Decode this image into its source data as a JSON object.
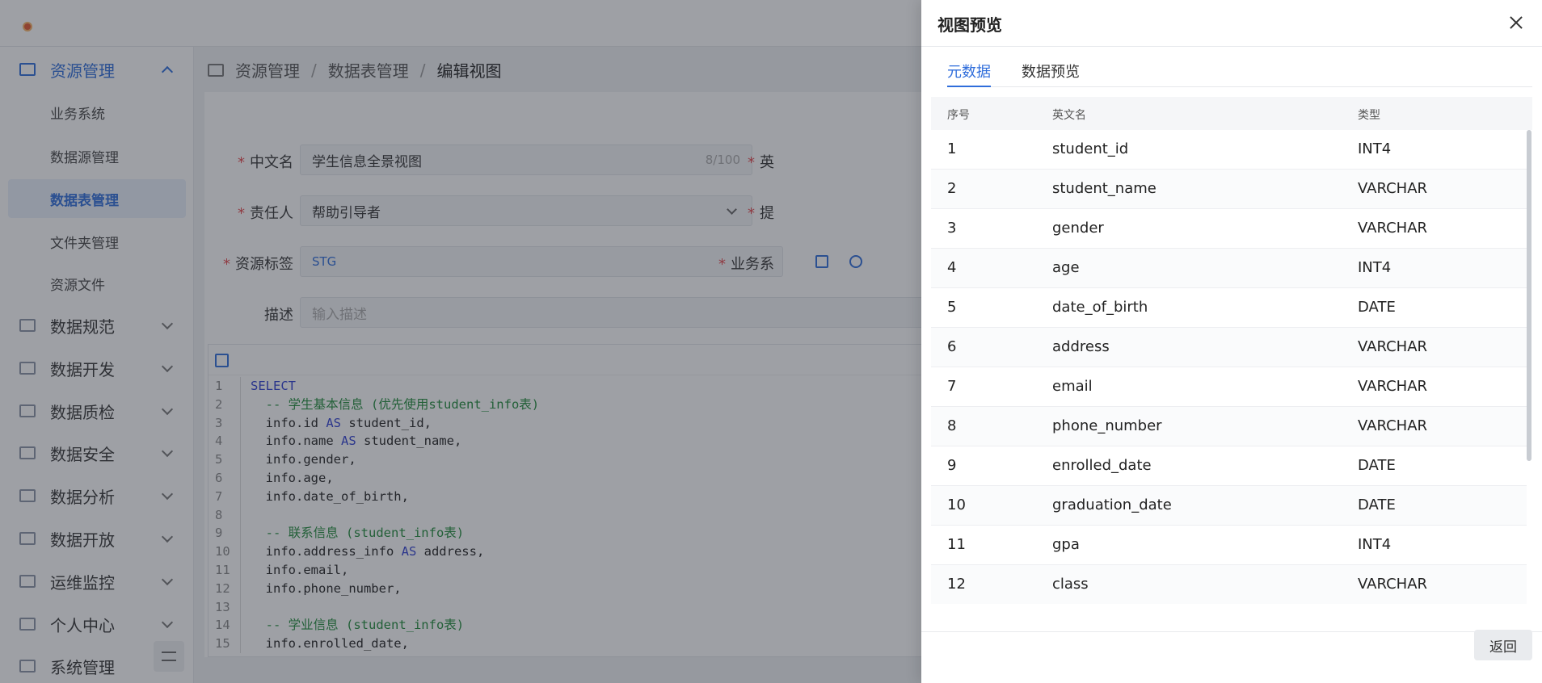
{
  "sidebar": {
    "groups": [
      {
        "label": "资源管理",
        "expanded": true
      },
      {
        "label": "数据规范"
      },
      {
        "label": "数据开发"
      },
      {
        "label": "数据质检"
      },
      {
        "label": "数据安全"
      },
      {
        "label": "数据分析"
      },
      {
        "label": "数据开放"
      },
      {
        "label": "运维监控"
      },
      {
        "label": "个人中心"
      },
      {
        "label": "系统管理"
      }
    ],
    "submenu": [
      "业务系统",
      "数据源管理",
      "数据表管理",
      "文件夹管理",
      "资源文件"
    ],
    "active_submenu": "数据表管理"
  },
  "breadcrumb": {
    "items": [
      "资源管理",
      "数据表管理",
      "编辑视图"
    ],
    "separator": "/"
  },
  "form": {
    "cn_name_label": "中文名",
    "cn_name_value": "学生信息全景视图",
    "cn_name_counter": "8/100",
    "en_name_label_fragment": "英",
    "owner_label": "责任人",
    "owner_value": "帮助引导者",
    "second_label_fragment": "提",
    "tag_label": "资源标签",
    "tag_value": "STG",
    "biz_label_fragment": "业务系",
    "desc_label": "描述",
    "desc_placeholder": "输入描述",
    "required_mark": "*"
  },
  "editor": {
    "lines": [
      {
        "n": "1",
        "parts": [
          {
            "t": "SELECT",
            "k": "kw"
          }
        ]
      },
      {
        "n": "2",
        "parts": [
          {
            "t": "  -- 学生基本信息 (优先使用student_info表)",
            "k": "cm"
          }
        ]
      },
      {
        "n": "3",
        "parts": [
          {
            "t": "  info.id ",
            "k": "tx"
          },
          {
            "t": "AS",
            "k": "kw"
          },
          {
            "t": " student_id,",
            "k": "tx"
          }
        ]
      },
      {
        "n": "4",
        "parts": [
          {
            "t": "  info.name ",
            "k": "tx"
          },
          {
            "t": "AS",
            "k": "kw"
          },
          {
            "t": " student_name,",
            "k": "tx"
          }
        ]
      },
      {
        "n": "5",
        "parts": [
          {
            "t": "  info.gender,",
            "k": "tx"
          }
        ]
      },
      {
        "n": "6",
        "parts": [
          {
            "t": "  info.age,",
            "k": "tx"
          }
        ]
      },
      {
        "n": "7",
        "parts": [
          {
            "t": "  info.date_of_birth,",
            "k": "tx"
          }
        ]
      },
      {
        "n": "8",
        "parts": [
          {
            "t": "",
            "k": "tx"
          }
        ]
      },
      {
        "n": "9",
        "parts": [
          {
            "t": "  -- 联系信息 (student_info表)",
            "k": "cm"
          }
        ]
      },
      {
        "n": "10",
        "parts": [
          {
            "t": "  info.address_info ",
            "k": "tx"
          },
          {
            "t": "AS",
            "k": "kw"
          },
          {
            "t": " address,",
            "k": "tx"
          }
        ]
      },
      {
        "n": "11",
        "parts": [
          {
            "t": "  info.email,",
            "k": "tx"
          }
        ]
      },
      {
        "n": "12",
        "parts": [
          {
            "t": "  info.phone_number,",
            "k": "tx"
          }
        ]
      },
      {
        "n": "13",
        "parts": [
          {
            "t": "",
            "k": "tx"
          }
        ]
      },
      {
        "n": "14",
        "parts": [
          {
            "t": "  -- 学业信息 (student_info表)",
            "k": "cm"
          }
        ]
      },
      {
        "n": "15",
        "parts": [
          {
            "t": "  info.enrolled_date,",
            "k": "tx"
          }
        ]
      }
    ]
  },
  "drawer": {
    "title": "视图预览",
    "tabs": [
      "元数据",
      "数据预览"
    ],
    "active_tab": "元数据",
    "columns": [
      "序号",
      "英文名",
      "类型"
    ],
    "rows": [
      [
        "1",
        "student_id",
        "INT4"
      ],
      [
        "2",
        "student_name",
        "VARCHAR"
      ],
      [
        "3",
        "gender",
        "VARCHAR"
      ],
      [
        "4",
        "age",
        "INT4"
      ],
      [
        "5",
        "date_of_birth",
        "DATE"
      ],
      [
        "6",
        "address",
        "VARCHAR"
      ],
      [
        "7",
        "email",
        "VARCHAR"
      ],
      [
        "8",
        "phone_number",
        "VARCHAR"
      ],
      [
        "9",
        "enrolled_date",
        "DATE"
      ],
      [
        "10",
        "graduation_date",
        "DATE"
      ],
      [
        "11",
        "gpa",
        "INT4"
      ],
      [
        "12",
        "class",
        "VARCHAR"
      ]
    ],
    "return_label": "返回"
  }
}
